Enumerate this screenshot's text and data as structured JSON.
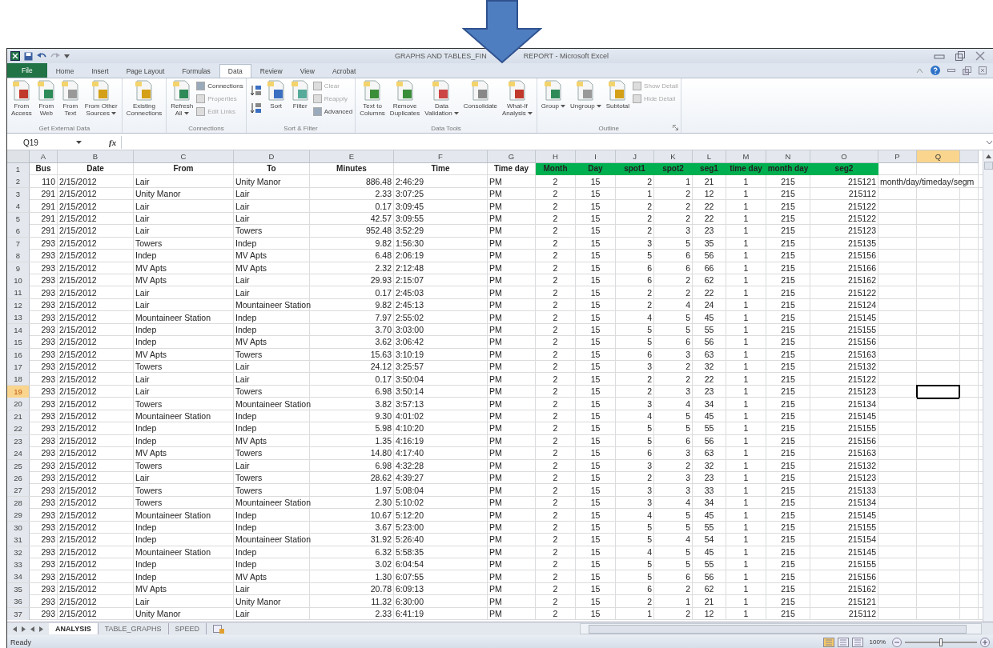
{
  "window": {
    "title_parts": [
      "GRAPHS AND TABLES_FIN",
      "REPORT - Microsoft Excel"
    ]
  },
  "menu_tabs": [
    {
      "label": "File",
      "selected": false,
      "kind": "file"
    },
    {
      "label": "Home",
      "selected": false,
      "kind": "tab"
    },
    {
      "label": "Insert",
      "selected": false,
      "kind": "tab"
    },
    {
      "label": "Page Layout",
      "selected": false,
      "kind": "tab"
    },
    {
      "label": "Formulas",
      "selected": false,
      "kind": "tab"
    },
    {
      "label": "Data",
      "selected": true,
      "kind": "tab"
    },
    {
      "label": "Review",
      "selected": false,
      "kind": "tab"
    },
    {
      "label": "View",
      "selected": false,
      "kind": "tab"
    },
    {
      "label": "Acrobat",
      "selected": false,
      "kind": "tab"
    }
  ],
  "ribbon": {
    "groups": [
      {
        "label": "Get External Data",
        "items": [
          {
            "kind": "large",
            "lines": [
              "From",
              "Access"
            ],
            "dropdown": false
          },
          {
            "kind": "large",
            "lines": [
              "From",
              "Web"
            ],
            "dropdown": false
          },
          {
            "kind": "large",
            "lines": [
              "From",
              "Text"
            ],
            "dropdown": false
          },
          {
            "kind": "large",
            "lines": [
              "From Other",
              "Sources"
            ],
            "dropdown": true
          }
        ]
      },
      {
        "items": [
          {
            "kind": "large",
            "lines": [
              "Existing",
              "Connections"
            ],
            "dropdown": false
          }
        ]
      },
      {
        "label": "Connections",
        "items": [
          {
            "kind": "large",
            "lines": [
              "Refresh",
              "All"
            ],
            "dropdown": true
          },
          {
            "kind": "stack",
            "items": [
              {
                "label": "Connections",
                "disabled": false
              },
              {
                "label": "Properties",
                "disabled": true
              },
              {
                "label": "Edit Links",
                "disabled": true
              }
            ]
          }
        ]
      },
      {
        "label": "Sort & Filter",
        "items": [
          {
            "kind": "sort-pair"
          },
          {
            "kind": "large",
            "lines": [
              "Sort"
            ],
            "dropdown": false
          },
          {
            "kind": "large",
            "lines": [
              "Filter"
            ],
            "dropdown": false
          },
          {
            "kind": "stack",
            "items": [
              {
                "label": "Clear",
                "disabled": true
              },
              {
                "label": "Reapply",
                "disabled": true
              },
              {
                "label": "Advanced",
                "disabled": false
              }
            ]
          }
        ]
      },
      {
        "label": "Data Tools",
        "items": [
          {
            "kind": "large",
            "lines": [
              "Text to",
              "Columns"
            ],
            "dropdown": false
          },
          {
            "kind": "large",
            "lines": [
              "Remove",
              "Duplicates"
            ],
            "dropdown": false
          },
          {
            "kind": "large",
            "lines": [
              "Data",
              "Validation"
            ],
            "dropdown": true
          },
          {
            "kind": "large",
            "lines": [
              "Consolidate"
            ],
            "dropdown": false
          },
          {
            "kind": "large",
            "lines": [
              "What-If",
              "Analysis"
            ],
            "dropdown": true
          }
        ]
      },
      {
        "label": "Outline",
        "items": [
          {
            "kind": "large",
            "lines": [
              "Group"
            ],
            "dropdown": true
          },
          {
            "kind": "large",
            "lines": [
              "Ungroup"
            ],
            "dropdown": true
          },
          {
            "kind": "large",
            "lines": [
              "Subtotal"
            ],
            "dropdown": false
          },
          {
            "kind": "stack",
            "items": [
              {
                "label": "Show Detail",
                "disabled": true
              },
              {
                "label": "Hide Detail",
                "disabled": true
              }
            ]
          }
        ]
      }
    ]
  },
  "formula_bar": {
    "name_box": "Q19",
    "fx": "fx"
  },
  "columns": [
    {
      "letter": "A",
      "selected": false
    },
    {
      "letter": "B",
      "selected": false
    },
    {
      "letter": "C",
      "selected": false
    },
    {
      "letter": "D",
      "selected": false
    },
    {
      "letter": "E",
      "selected": false
    },
    {
      "letter": "F",
      "selected": false
    },
    {
      "letter": "G",
      "selected": false
    },
    {
      "letter": "H",
      "selected": false
    },
    {
      "letter": "I",
      "selected": false
    },
    {
      "letter": "J",
      "selected": false
    },
    {
      "letter": "K",
      "selected": false
    },
    {
      "letter": "L",
      "selected": false
    },
    {
      "letter": "M",
      "selected": false
    },
    {
      "letter": "N",
      "selected": false
    },
    {
      "letter": "O",
      "selected": false
    },
    {
      "letter": "P",
      "selected": false
    },
    {
      "letter": "Q",
      "selected": true
    }
  ],
  "header_row": {
    "num": "1",
    "cells": [
      {
        "text": "Bus",
        "highlighted": false
      },
      {
        "text": "Date",
        "highlighted": false
      },
      {
        "text": "From",
        "highlighted": false
      },
      {
        "text": "To",
        "highlighted": false
      },
      {
        "text": "Minutes",
        "highlighted": false
      },
      {
        "text": "Time",
        "highlighted": false
      },
      {
        "text": "Time day",
        "highlighted": false
      },
      {
        "text": "Month",
        "highlighted": true
      },
      {
        "text": "Day",
        "highlighted": true
      },
      {
        "text": "spot1",
        "highlighted": true
      },
      {
        "text": "spot2",
        "highlighted": true
      },
      {
        "text": "seg1",
        "highlighted": true
      },
      {
        "text": "time day",
        "highlighted": true
      },
      {
        "text": "month day",
        "highlighted": true
      },
      {
        "text": "seg2",
        "highlighted": true
      }
    ]
  },
  "rows": [
    {
      "num": "2",
      "selected": false,
      "cells": [
        "110",
        "2/15/2012",
        "Lair",
        "Unity Manor",
        "886.48",
        "2:46:29",
        "PM",
        "2",
        "15",
        "2",
        "1",
        "21",
        "1",
        "215",
        "215121"
      ],
      "note": "month/day/timeday/segm"
    },
    {
      "num": "3",
      "selected": false,
      "cells": [
        "291",
        "2/15/2012",
        "Unity Manor",
        "Lair",
        "2.33",
        "3:07:25",
        "PM",
        "2",
        "15",
        "1",
        "2",
        "12",
        "1",
        "215",
        "215112"
      ]
    },
    {
      "num": "4",
      "selected": false,
      "cells": [
        "291",
        "2/15/2012",
        "Lair",
        "Lair",
        "0.17",
        "3:09:45",
        "PM",
        "2",
        "15",
        "2",
        "2",
        "22",
        "1",
        "215",
        "215122"
      ]
    },
    {
      "num": "5",
      "selected": false,
      "cells": [
        "291",
        "2/15/2012",
        "Lair",
        "Lair",
        "42.57",
        "3:09:55",
        "PM",
        "2",
        "15",
        "2",
        "2",
        "22",
        "1",
        "215",
        "215122"
      ]
    },
    {
      "num": "6",
      "selected": false,
      "cells": [
        "291",
        "2/15/2012",
        "Lair",
        "Towers",
        "952.48",
        "3:52:29",
        "PM",
        "2",
        "15",
        "2",
        "3",
        "23",
        "1",
        "215",
        "215123"
      ]
    },
    {
      "num": "7",
      "selected": false,
      "cells": [
        "293",
        "2/15/2012",
        "Towers",
        "Indep",
        "9.82",
        "1:56:30",
        "PM",
        "2",
        "15",
        "3",
        "5",
        "35",
        "1",
        "215",
        "215135"
      ]
    },
    {
      "num": "8",
      "selected": false,
      "cells": [
        "293",
        "2/15/2012",
        "Indep",
        "MV Apts",
        "6.48",
        "2:06:19",
        "PM",
        "2",
        "15",
        "5",
        "6",
        "56",
        "1",
        "215",
        "215156"
      ]
    },
    {
      "num": "9",
      "selected": false,
      "cells": [
        "293",
        "2/15/2012",
        "MV Apts",
        "MV Apts",
        "2.32",
        "2:12:48",
        "PM",
        "2",
        "15",
        "6",
        "6",
        "66",
        "1",
        "215",
        "215166"
      ]
    },
    {
      "num": "10",
      "selected": false,
      "cells": [
        "293",
        "2/15/2012",
        "MV Apts",
        "Lair",
        "29.93",
        "2:15:07",
        "PM",
        "2",
        "15",
        "6",
        "2",
        "62",
        "1",
        "215",
        "215162"
      ]
    },
    {
      "num": "11",
      "selected": false,
      "cells": [
        "293",
        "2/15/2012",
        "Lair",
        "Lair",
        "0.17",
        "2:45:03",
        "PM",
        "2",
        "15",
        "2",
        "2",
        "22",
        "1",
        "215",
        "215122"
      ]
    },
    {
      "num": "12",
      "selected": false,
      "cells": [
        "293",
        "2/15/2012",
        "Lair",
        "Mountaineer Station",
        "9.82",
        "2:45:13",
        "PM",
        "2",
        "15",
        "2",
        "4",
        "24",
        "1",
        "215",
        "215124"
      ]
    },
    {
      "num": "13",
      "selected": false,
      "cells": [
        "293",
        "2/15/2012",
        "Mountaineer Station",
        "Indep",
        "7.97",
        "2:55:02",
        "PM",
        "2",
        "15",
        "4",
        "5",
        "45",
        "1",
        "215",
        "215145"
      ]
    },
    {
      "num": "14",
      "selected": false,
      "cells": [
        "293",
        "2/15/2012",
        "Indep",
        "Indep",
        "3.70",
        "3:03:00",
        "PM",
        "2",
        "15",
        "5",
        "5",
        "55",
        "1",
        "215",
        "215155"
      ]
    },
    {
      "num": "15",
      "selected": false,
      "cells": [
        "293",
        "2/15/2012",
        "Indep",
        "MV Apts",
        "3.62",
        "3:06:42",
        "PM",
        "2",
        "15",
        "5",
        "6",
        "56",
        "1",
        "215",
        "215156"
      ]
    },
    {
      "num": "16",
      "selected": false,
      "cells": [
        "293",
        "2/15/2012",
        "MV Apts",
        "Towers",
        "15.63",
        "3:10:19",
        "PM",
        "2",
        "15",
        "6",
        "3",
        "63",
        "1",
        "215",
        "215163"
      ]
    },
    {
      "num": "17",
      "selected": false,
      "cells": [
        "293",
        "2/15/2012",
        "Towers",
        "Lair",
        "24.12",
        "3:25:57",
        "PM",
        "2",
        "15",
        "3",
        "2",
        "32",
        "1",
        "215",
        "215132"
      ]
    },
    {
      "num": "18",
      "selected": false,
      "cells": [
        "293",
        "2/15/2012",
        "Lair",
        "Lair",
        "0.17",
        "3:50:04",
        "PM",
        "2",
        "15",
        "2",
        "2",
        "22",
        "1",
        "215",
        "215122"
      ]
    },
    {
      "num": "19",
      "selected": true,
      "cells": [
        "293",
        "2/15/2012",
        "Lair",
        "Towers",
        "6.98",
        "3:50:14",
        "PM",
        "2",
        "15",
        "2",
        "3",
        "23",
        "1",
        "215",
        "215123"
      ]
    },
    {
      "num": "20",
      "selected": false,
      "cells": [
        "293",
        "2/15/2012",
        "Towers",
        "Mountaineer Station",
        "3.82",
        "3:57:13",
        "PM",
        "2",
        "15",
        "3",
        "4",
        "34",
        "1",
        "215",
        "215134"
      ]
    },
    {
      "num": "21",
      "selected": false,
      "cells": [
        "293",
        "2/15/2012",
        "Mountaineer Station",
        "Indep",
        "9.30",
        "4:01:02",
        "PM",
        "2",
        "15",
        "4",
        "5",
        "45",
        "1",
        "215",
        "215145"
      ]
    },
    {
      "num": "22",
      "selected": false,
      "cells": [
        "293",
        "2/15/2012",
        "Indep",
        "Indep",
        "5.98",
        "4:10:20",
        "PM",
        "2",
        "15",
        "5",
        "5",
        "55",
        "1",
        "215",
        "215155"
      ]
    },
    {
      "num": "23",
      "selected": false,
      "cells": [
        "293",
        "2/15/2012",
        "Indep",
        "MV Apts",
        "1.35",
        "4:16:19",
        "PM",
        "2",
        "15",
        "5",
        "6",
        "56",
        "1",
        "215",
        "215156"
      ]
    },
    {
      "num": "24",
      "selected": false,
      "cells": [
        "293",
        "2/15/2012",
        "MV Apts",
        "Towers",
        "14.80",
        "4:17:40",
        "PM",
        "2",
        "15",
        "6",
        "3",
        "63",
        "1",
        "215",
        "215163"
      ]
    },
    {
      "num": "25",
      "selected": false,
      "cells": [
        "293",
        "2/15/2012",
        "Towers",
        "Lair",
        "6.98",
        "4:32:28",
        "PM",
        "2",
        "15",
        "3",
        "2",
        "32",
        "1",
        "215",
        "215132"
      ]
    },
    {
      "num": "26",
      "selected": false,
      "cells": [
        "293",
        "2/15/2012",
        "Lair",
        "Towers",
        "28.62",
        "4:39:27",
        "PM",
        "2",
        "15",
        "2",
        "3",
        "23",
        "1",
        "215",
        "215123"
      ]
    },
    {
      "num": "27",
      "selected": false,
      "cells": [
        "293",
        "2/15/2012",
        "Towers",
        "Towers",
        "1.97",
        "5:08:04",
        "PM",
        "2",
        "15",
        "3",
        "3",
        "33",
        "1",
        "215",
        "215133"
      ]
    },
    {
      "num": "28",
      "selected": false,
      "cells": [
        "293",
        "2/15/2012",
        "Towers",
        "Mountaineer Station",
        "2.30",
        "5:10:02",
        "PM",
        "2",
        "15",
        "3",
        "4",
        "34",
        "1",
        "215",
        "215134"
      ]
    },
    {
      "num": "29",
      "selected": false,
      "cells": [
        "293",
        "2/15/2012",
        "Mountaineer Station",
        "Indep",
        "10.67",
        "5:12:20",
        "PM",
        "2",
        "15",
        "4",
        "5",
        "45",
        "1",
        "215",
        "215145"
      ]
    },
    {
      "num": "30",
      "selected": false,
      "cells": [
        "293",
        "2/15/2012",
        "Indep",
        "Indep",
        "3.67",
        "5:23:00",
        "PM",
        "2",
        "15",
        "5",
        "5",
        "55",
        "1",
        "215",
        "215155"
      ]
    },
    {
      "num": "31",
      "selected": false,
      "cells": [
        "293",
        "2/15/2012",
        "Indep",
        "Mountaineer Station",
        "31.92",
        "5:26:40",
        "PM",
        "2",
        "15",
        "5",
        "4",
        "54",
        "1",
        "215",
        "215154"
      ]
    },
    {
      "num": "32",
      "selected": false,
      "cells": [
        "293",
        "2/15/2012",
        "Mountaineer Station",
        "Indep",
        "6.32",
        "5:58:35",
        "PM",
        "2",
        "15",
        "4",
        "5",
        "45",
        "1",
        "215",
        "215145"
      ]
    },
    {
      "num": "33",
      "selected": false,
      "cells": [
        "293",
        "2/15/2012",
        "Indep",
        "Indep",
        "3.02",
        "6:04:54",
        "PM",
        "2",
        "15",
        "5",
        "5",
        "55",
        "1",
        "215",
        "215155"
      ]
    },
    {
      "num": "34",
      "selected": false,
      "cells": [
        "293",
        "2/15/2012",
        "Indep",
        "MV Apts",
        "1.30",
        "6:07:55",
        "PM",
        "2",
        "15",
        "5",
        "6",
        "56",
        "1",
        "215",
        "215156"
      ]
    },
    {
      "num": "35",
      "selected": false,
      "cells": [
        "293",
        "2/15/2012",
        "MV Apts",
        "Lair",
        "20.78",
        "6:09:13",
        "PM",
        "2",
        "15",
        "6",
        "2",
        "62",
        "1",
        "215",
        "215162"
      ]
    },
    {
      "num": "36",
      "selected": false,
      "cells": [
        "293",
        "2/15/2012",
        "Lair",
        "Unity Manor",
        "11.32",
        "6:30:00",
        "PM",
        "2",
        "15",
        "2",
        "1",
        "21",
        "1",
        "215",
        "215121"
      ]
    },
    {
      "num": "37",
      "selected": false,
      "cells": [
        "293",
        "2/15/2012",
        "Unity Manor",
        "Lair",
        "2.33",
        "6:41:19",
        "PM",
        "2",
        "15",
        "1",
        "2",
        "12",
        "1",
        "215",
        "215112"
      ]
    }
  ],
  "sheet_tabs": [
    {
      "label": "ANALYSIS",
      "selected": true
    },
    {
      "label": "TABLE_GRAPHS",
      "selected": false
    },
    {
      "label": "SPEED",
      "selected": false
    }
  ],
  "status_bar": {
    "status": "Ready",
    "zoom": "100%",
    "zoom_level": {
      "level": 0.5
    },
    "views": [
      {
        "selected": true
      },
      {
        "selected": false
      },
      {
        "selected": false
      }
    ]
  }
}
